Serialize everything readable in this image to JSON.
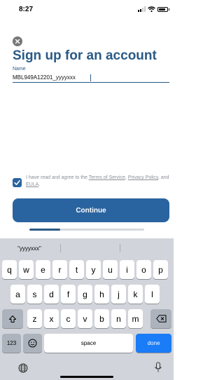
{
  "status_bar": {
    "time": "8:27",
    "icons": [
      "signal-icon",
      "wifi-icon",
      "battery-icon"
    ]
  },
  "header": {
    "close_icon": "close-icon",
    "title": "Sign up for an account"
  },
  "form": {
    "name_label": "Name",
    "name_value": "MBL949A12201_yyyyxxx"
  },
  "agreement": {
    "checked": true,
    "prefix": "I have read and agree to the ",
    "terms_link": "Terms of Service",
    "sep": ",",
    "privacy_link": "Privacy Policy",
    "and": ", and ",
    "eula_link": "EULA",
    "suffix": "."
  },
  "continue_label": "Continue",
  "progress": {
    "value": 0.27
  },
  "colors": {
    "brand_primary": "#2a5a86",
    "button": "#2a64a0",
    "keyboard_bg": "#d1d4da",
    "done_key": "#1a7cf7"
  },
  "keyboard": {
    "suggestions": [
      "\"yyyyxxx\"",
      "",
      ""
    ],
    "row1": [
      "q",
      "w",
      "e",
      "r",
      "t",
      "y",
      "u",
      "i",
      "o",
      "p"
    ],
    "row2": [
      "a",
      "s",
      "d",
      "f",
      "g",
      "h",
      "j",
      "k",
      "l"
    ],
    "row3": [
      "z",
      "x",
      "c",
      "v",
      "b",
      "n",
      "m"
    ],
    "numbers_label": "123",
    "space_label": "space",
    "done_label": "done",
    "shift_icon": "shift-icon",
    "delete_icon": "delete-icon",
    "emoji_icon": "emoji-icon",
    "globe_icon": "globe-icon",
    "mic_icon": "microphone-icon"
  }
}
